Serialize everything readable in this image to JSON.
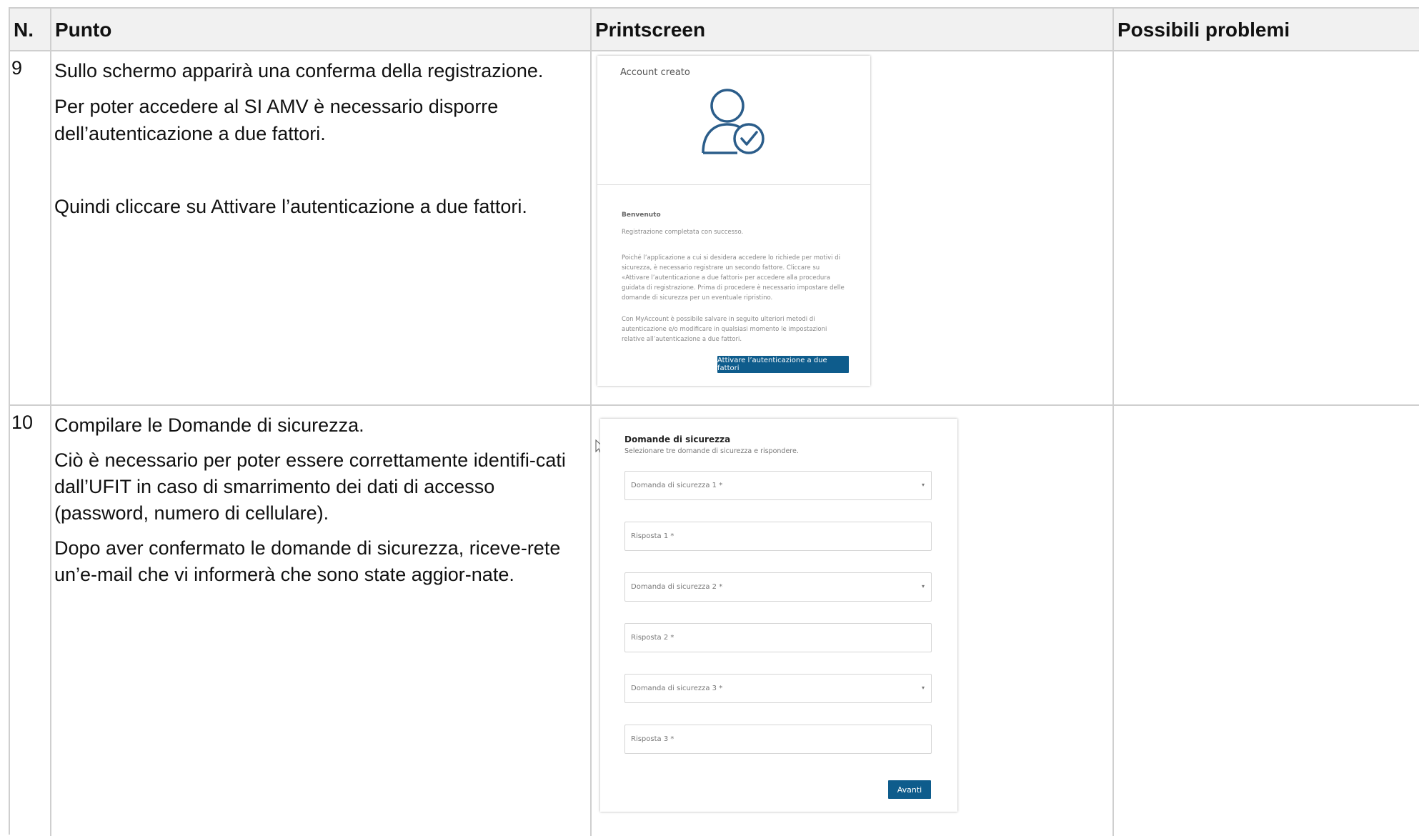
{
  "header": {
    "col_num": "N.",
    "col_step": "Punto",
    "col_screen": "Printscreen",
    "col_problems": "Possibili problemi"
  },
  "rows": [
    {
      "num": "9",
      "paragraphs": [
        "Sullo schermo apparirà una conferma della registrazione.",
        "Per poter accedere al SI AMV è necessario disporre dell’autenticazione a due fattori.",
        "Quindi cliccare su Attivare l’autenticazione a due fattori."
      ],
      "screenshot": {
        "title": "Account creato",
        "icon": "user-check-icon",
        "welcome": "Benvenuto",
        "success": "Registrazione completata con successo.",
        "info1": "Poiché l’applicazione a cui si desidera accedere lo richiede per motivi di sicurezza, è necessario registrare un secondo fattore. Cliccare su «Attivare l’autenticazione a due fattori» per accedere alla procedura guidata di registrazione. Prima di procedere è necessario impostare delle domande di sicurezza per un eventuale ripristino.",
        "info2": "Con MyAccount è possibile salvare in seguito ulteriori metodi di autenticazione e/o modificare in qualsiasi momento le impostazioni relative all’autenticazione a due fattori.",
        "button": "Attivare l’autenticazione a due fattori",
        "accent": "#0e5c8c"
      },
      "problems": ""
    },
    {
      "num": "10",
      "paragraphs": [
        "Compilare le Domande di sicurezza.",
        "Ciò è necessario per poter essere correttamente identifi-cati dall’UFIT in caso di smarrimento dei dati di accesso (password, numero di cellulare).",
        "Dopo aver confermato le domande di sicurezza, riceve-rete un’e-mail che vi informerà che sono state aggior-nate."
      ],
      "screenshot": {
        "title": "Domande di sicurezza",
        "subtitle": "Selezionare tre domande di sicurezza e rispondere.",
        "fields": [
          {
            "label": "Domanda di sicurezza 1 *",
            "type": "select"
          },
          {
            "label": "Risposta 1 *",
            "type": "text"
          },
          {
            "label": "Domanda di sicurezza 2 *",
            "type": "select"
          },
          {
            "label": "Risposta 2 *",
            "type": "text"
          },
          {
            "label": "Domanda di sicurezza 3 *",
            "type": "select"
          },
          {
            "label": "Risposta 3 *",
            "type": "text"
          }
        ],
        "button": "Avanti",
        "caret_glyph": "▾"
      },
      "problems": ""
    }
  ]
}
